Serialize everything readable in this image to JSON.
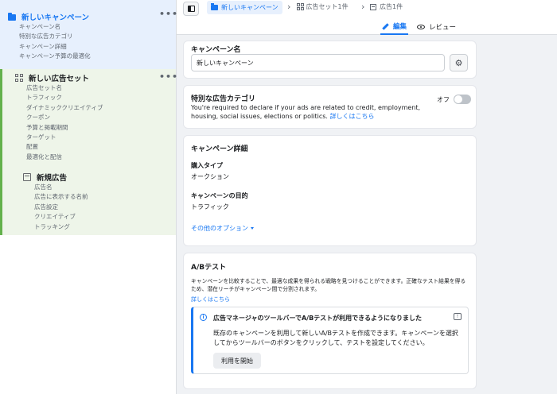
{
  "sidebar": {
    "campaign": {
      "label": "新しいキャンペーン",
      "items": [
        "キャンペーン名",
        "特別な広告カテゴリ",
        "キャンペーン詳細",
        "キャンペーン予算の最適化"
      ]
    },
    "adset": {
      "label": "新しい広告セット",
      "items": [
        "広告セット名",
        "トラフィック",
        "ダイナミッククリエイティブ",
        "クーポン",
        "予算と掲載期間",
        "ターゲット",
        "配置",
        "最適化と配信"
      ]
    },
    "ad": {
      "label": "新規広告",
      "items": [
        "広告名",
        "広告に表示する名前",
        "広告設定",
        "クリエイティブ",
        "トラッキング"
      ]
    },
    "more_icon": "ellipsis-icon"
  },
  "topbar": {
    "crumb_campaign": "新しいキャンペーン",
    "crumb_adset": "広告セット1件",
    "crumb_ad": "広告1件",
    "tab_edit": "編集",
    "tab_review": "レビュー"
  },
  "campaign_name": {
    "title": "キャンペーン名",
    "value": "新しいキャンペーン"
  },
  "special_category": {
    "title": "特別な広告カテゴリ",
    "text": "You're required to declare if your ads are related to credit, employment, housing, social issues, elections or politics. ",
    "link": "詳しくはこちら",
    "toggle_label": "オフ",
    "toggle_on": false
  },
  "campaign_details": {
    "title": "キャンペーン詳細",
    "buy_type_label": "購入タイプ",
    "buy_type_value": "オークション",
    "objective_label": "キャンペーンの目的",
    "objective_value": "トラフィック",
    "more_options": "その他のオプション"
  },
  "ab_test": {
    "title": "A/Bテスト",
    "description": "キャンペーンを比較することで、最適な成果を得られる戦略を見つけることができます。正確なテスト結果を得るため、潜在リーチがキャンペーン間で分割されます。",
    "link": "詳しくはこちら",
    "notice_title": "広告マネージャのツールバーでA/Bテストが利用できるようになりました",
    "notice_body": "既存のキャンペーンを利用して新しいA/Bテストを作成できます。キャンペーンを選択してからツールバーのボタンをクリックして、テストを設定してください。",
    "notice_button": "利用を開始"
  },
  "colors": {
    "accent": "#1877f2",
    "campaign_bg": "#e7f0fd",
    "adset_bg": "#eef5e9",
    "adset_border": "#63b14c"
  }
}
